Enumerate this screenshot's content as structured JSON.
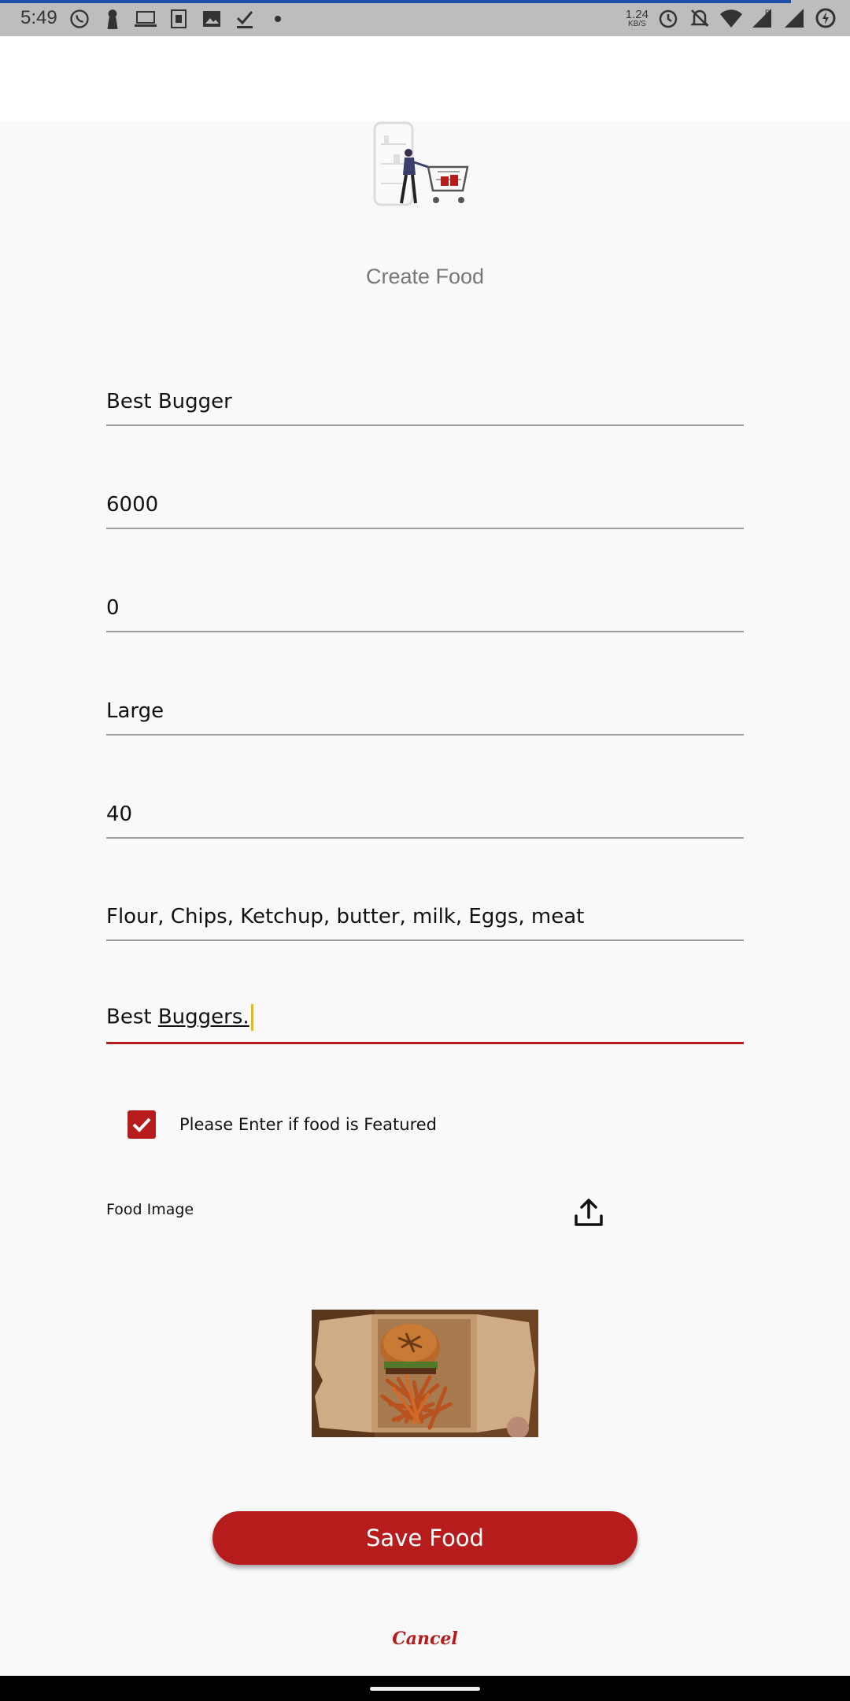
{
  "status_bar": {
    "time": "5:49",
    "net_speed_value": "1.24",
    "net_speed_unit": "KB/S"
  },
  "header": {
    "title": "Create Food"
  },
  "form": {
    "name_value": "Best Bugger",
    "price_value": "6000",
    "discount_value": "0",
    "size_value": "Large",
    "time_value": "40",
    "ingredients_value": "Flour, Chips, Ketchup, butter, milk, Eggs, meat",
    "description_value_plain": "Best ",
    "description_value_underlined": "Buggers.",
    "featured_label": "Please Enter if food is Featured",
    "featured_checked": true,
    "image_label": "Food Image"
  },
  "actions": {
    "save_label": "Save Food",
    "cancel_label": "Cancel"
  },
  "colors": {
    "accent": "#b71c1c",
    "caret": "#f2b705",
    "status_bar": "#bdbdbd",
    "progress": "#1c50a8"
  }
}
